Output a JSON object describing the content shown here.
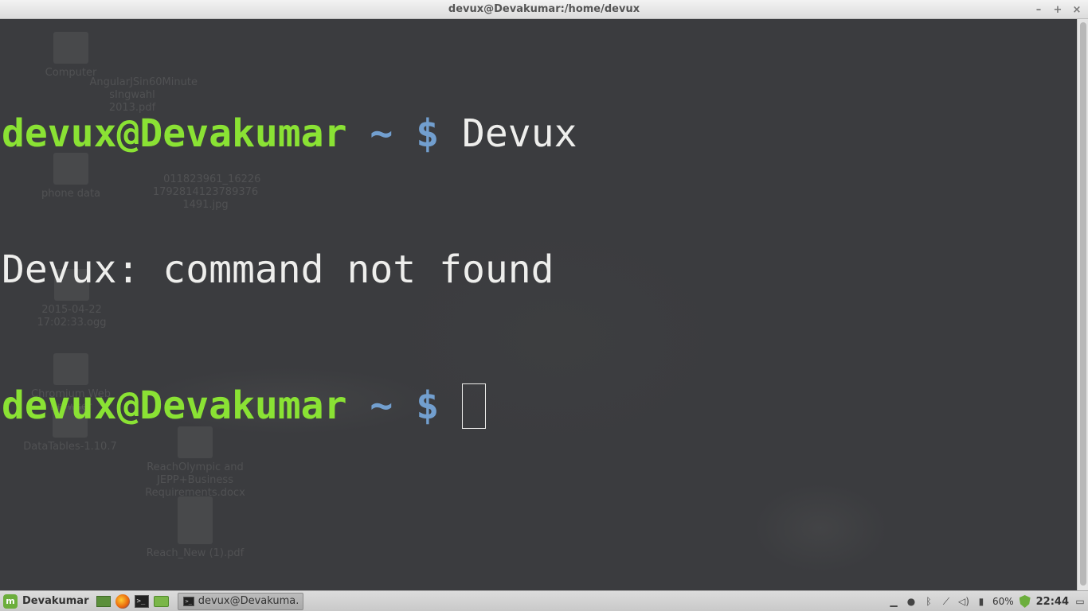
{
  "window": {
    "title": "devux@Devakumar:/home/devux",
    "minimize_glyph": "–",
    "maximize_glyph": "+",
    "close_glyph": "×"
  },
  "terminal": {
    "lines": [
      {
        "user": "devux@Devakumar",
        "path": "~ $",
        "command": " Devux"
      },
      {
        "output": "Devux: command not found"
      },
      {
        "user": "devux@Devakumar",
        "path": "~ $",
        "command": " "
      }
    ]
  },
  "desktop_ghost_icons": [
    {
      "label": "Computer"
    },
    {
      "label": "AngularJSin60Minute\nsIngwahl\n2013.pdf"
    },
    {
      "label": "phone data"
    },
    {
      "label": "011823961_16226\n1792814123789376\n1491.jpg"
    },
    {
      "label": "2015-04-22\n17:02:33.ogg"
    },
    {
      "label": "Chromium Web\nBrowser"
    },
    {
      "label": "DataTables-1.10.7"
    },
    {
      "label": "ReachOlympic and\nJEPP+Business\nRequirements.docx"
    },
    {
      "label": "Reach_New (1).pdf"
    }
  ],
  "panel": {
    "menu_label": "Devakumar",
    "task_label": "devux@Devakuma...",
    "battery": "60%",
    "clock": "22:44"
  },
  "colors": {
    "prompt_user": "#8ae234",
    "prompt_path": "#729fcf",
    "text": "#eeeeec",
    "background": "#3c3d3f"
  }
}
